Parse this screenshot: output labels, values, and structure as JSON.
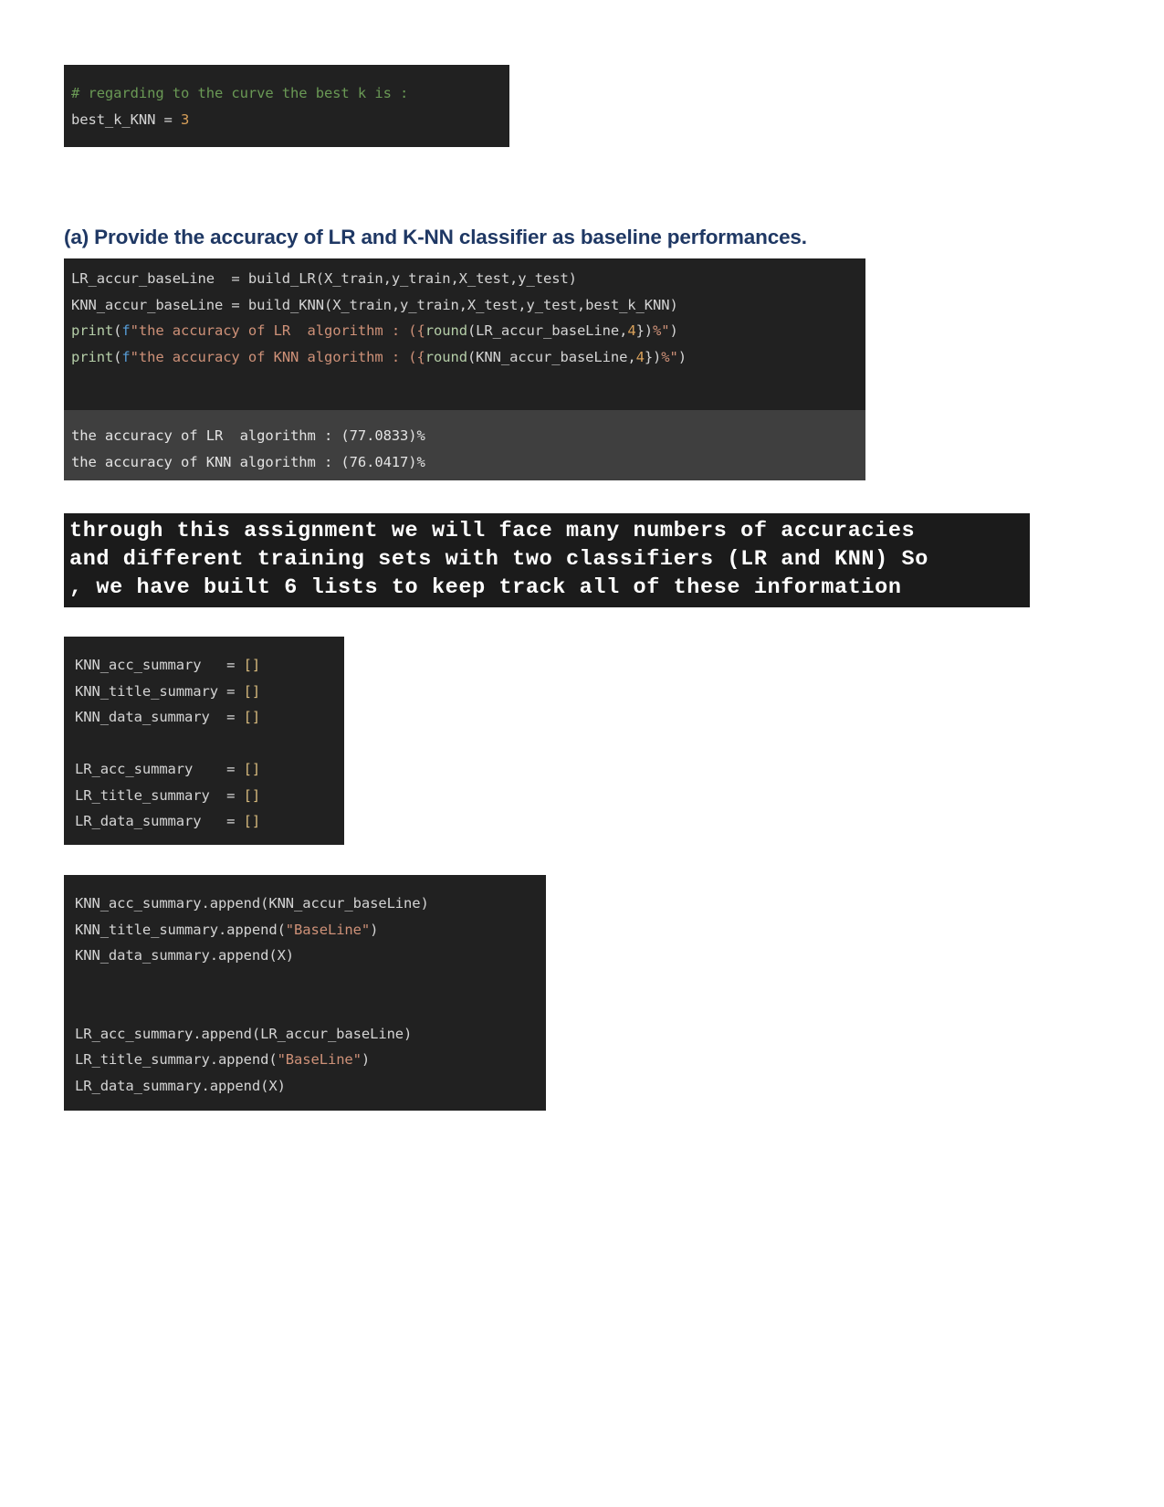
{
  "document": {
    "heading_a": "(a) Provide the accuracy of LR and K-NN classifier as baseline performances."
  },
  "cells": {
    "best_k": {
      "lines": {
        "comment": "# regarding to the curve the best k is :",
        "assign_var": "best_k_KNN",
        "assign_op": " = ",
        "assign_val": "3"
      }
    },
    "baseline": {
      "source": {
        "line1_var": "LR_accur_baseLine  = ",
        "line1_call": "build_LR(X_train,y_train,X_test,y_test)",
        "line2_var": "KNN_accur_baseLine = ",
        "line2_call": "build_KNN(X_train,y_train,X_test,y_test,best_k_KNN)",
        "print_kw": "print",
        "paren_open": "(",
        "f_prefix": "f",
        "lr_str_open": "\"the accuracy of LR  algorithm : ({",
        "round_kw": "round",
        "lr_round_args_open": "(LR_accur_baseLine,",
        "num4": "4",
        "round_close": ")",
        "lr_tail": "})",
        "pct_str": "%\"",
        "paren_close": ")",
        "knn_str_open": "\"the accuracy of KNN algorithm : ({",
        "knn_round_args_open": "(KNN_accur_baseLine,",
        "knn_tail": "})"
      },
      "output": {
        "line1": "the accuracy of LR  algorithm : (77.0833)%",
        "line2": "the accuracy of KNN algorithm : (76.0417)%"
      },
      "values": {
        "lr_accuracy": "77.0833",
        "knn_accuracy": "76.0417",
        "best_k": "3"
      }
    },
    "prose": {
      "line1": "through this assignment we will face many numbers of accuracies",
      "line2": "and different training sets with two classifiers (LR and KNN) So",
      "line3": ", we have built 6 lists to keep track all of these information"
    },
    "lists": {
      "rows": [
        {
          "name": "KNN_acc_summary   = ",
          "value": "[]"
        },
        {
          "name": "KNN_title_summary = ",
          "value": "[]"
        },
        {
          "name": "KNN_data_summary  = ",
          "value": "[]"
        },
        {
          "name": "",
          "value": ""
        },
        {
          "name": "LR_acc_summary    = ",
          "value": "[]"
        },
        {
          "name": "LR_title_summary  = ",
          "value": "[]"
        },
        {
          "name": "LR_data_summary   = ",
          "value": "[]"
        }
      ]
    },
    "append": {
      "knn_acc": "KNN_acc_summary.append(KNN_accur_baseLine)",
      "knn_title_pre": "KNN_title_summary.append(",
      "knn_title_str": "\"BaseLine\"",
      "knn_title_post": ")",
      "knn_data": "KNN_data_summary.append(X)",
      "lr_acc": "LR_acc_summary.append(LR_accur_baseLine)",
      "lr_title_pre": "LR_title_summary.append(",
      "lr_title_str": "\"BaseLine\"",
      "lr_title_post": ")",
      "lr_data": "LR_data_summary.append(X)"
    }
  },
  "colors": {
    "heading": "#1f3864",
    "cell_bg": "#212121",
    "output_bg": "#3f3f3f",
    "banner_bg": "#1b1b1b",
    "comment": "#6a9955",
    "string": "#ce9178",
    "function": "#b5cea8",
    "keyword_f": "#569cd6",
    "number": "#d8a05a",
    "bracket": "#d7ba7d",
    "plain_text": "#d4d4d4"
  }
}
